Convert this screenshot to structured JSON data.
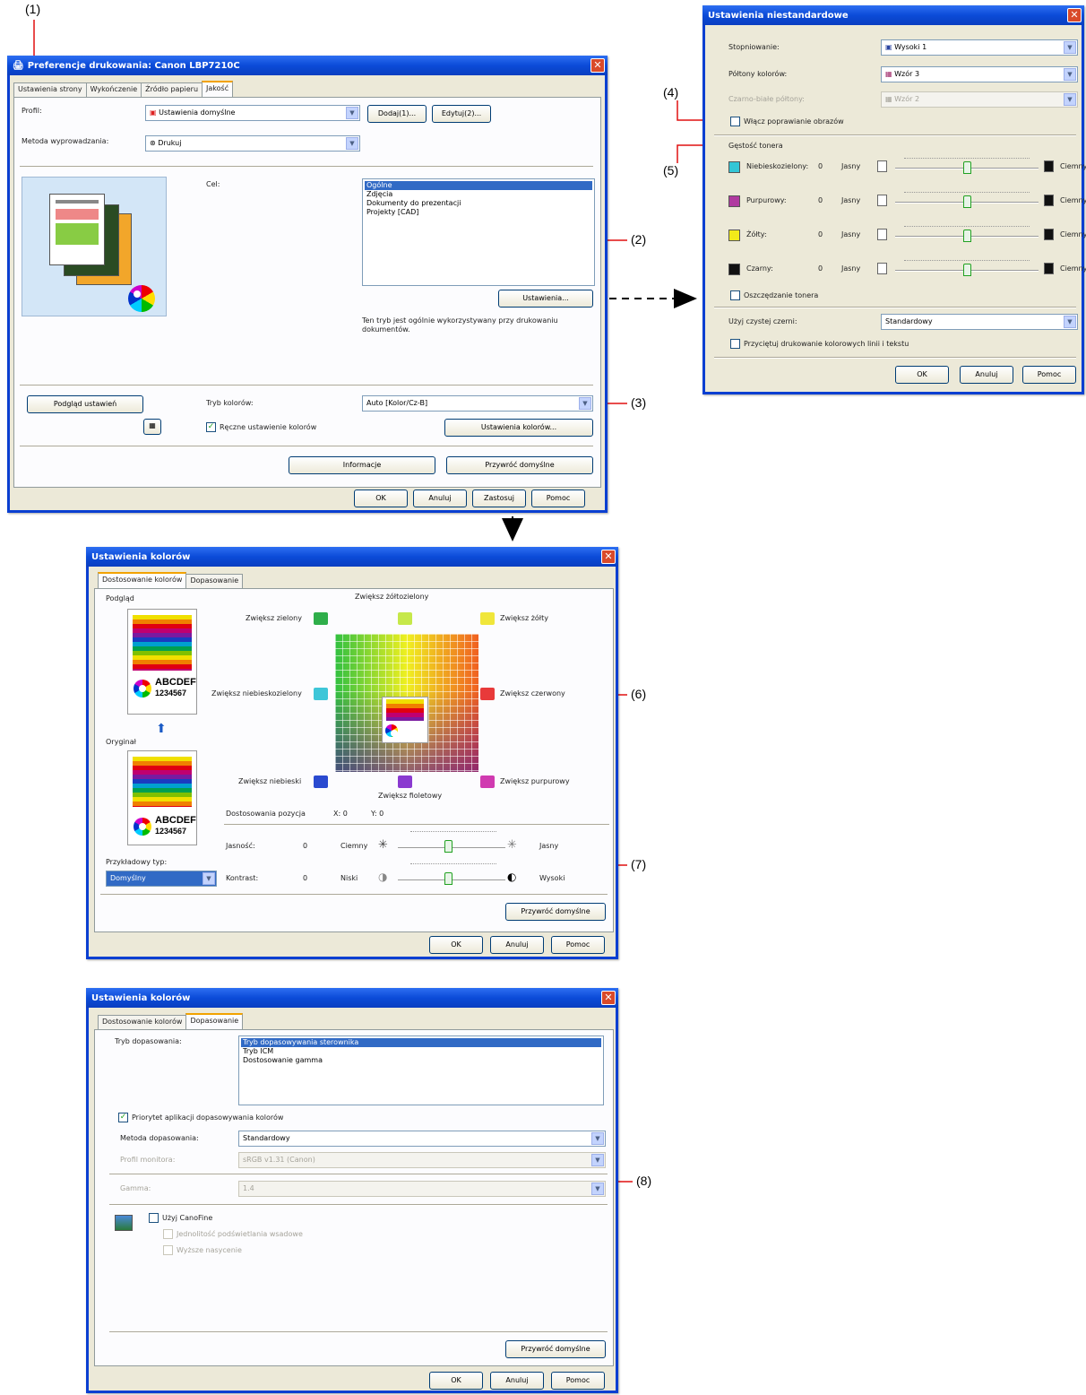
{
  "callouts": {
    "c1": "(1)",
    "c2": "(2)",
    "c3": "(3)",
    "c4": "(4)",
    "c5": "(5)",
    "c6": "(6)",
    "c7": "(7)",
    "c8": "(8)"
  },
  "win1": {
    "title": "Preferencje drukowania: Canon LBP7210C",
    "tabs": [
      "Ustawienia strony",
      "Wykończenie",
      "Źródło papieru",
      "Jakość"
    ],
    "profile_label": "Profil:",
    "profile_value": "Ustawienia domyślne",
    "add_btn": "Dodaj(1)...",
    "edit_btn": "Edytuj(2)...",
    "output_label": "Metoda wyprowadzania:",
    "output_value": "Drukuj",
    "objective_label": "Cel:",
    "objective_items": [
      "Ogólne",
      "Zdjęcia",
      "Dokumenty do prezentacji",
      "Projekty [CAD]"
    ],
    "settings_btn": "Ustawienia...",
    "description": "Ten tryb jest ogólnie wykorzystywany przy drukowaniu dokumentów.",
    "view_settings_btn": "Podgląd ustawień",
    "color_mode_label": "Tryb kolorów:",
    "color_mode_value": "Auto [Kolor/Cz-B]",
    "manual_color_label": "Ręczne ustawienie kolorów",
    "color_settings_btn": "Ustawienia kolorów...",
    "info_btn": "Informacje",
    "restore_btn": "Przywróć domyślne",
    "ok": "OK",
    "cancel": "Anuluj",
    "apply": "Zastosuj",
    "help": "Pomoc"
  },
  "win2": {
    "title": "Ustawienia niestandardowe",
    "gradation_label": "Stopniowanie:",
    "gradation_value": "Wysoki 1",
    "halftone_label": "Półtony kolorów:",
    "halftone_value": "Wzór 3",
    "mono_halftone_label": "Czarno-białe półtony:",
    "mono_halftone_value": "Wzór 2",
    "image_refine_label": "Włącz poprawianie obrazów",
    "toner_density_label": "Gęstość tonera",
    "toner_rows": [
      {
        "name": "Niebieskozielony:",
        "value": "0",
        "swatch": "#33c6d6"
      },
      {
        "name": "Purpurowy:",
        "value": "0",
        "swatch": "#b03aa0"
      },
      {
        "name": "Żółty:",
        "value": "0",
        "swatch": "#f2ea1a"
      },
      {
        "name": "Czarny:",
        "value": "0",
        "swatch": "#111111"
      }
    ],
    "light": "Jasny",
    "dark": "Ciemny",
    "toner_save_label": "Oszczędzanie tonera",
    "pure_black_label": "Użyj czystej czerni:",
    "pure_black_value": "Standardowy",
    "thin_lines_label": "Przyciętuj drukowanie kolorowych linii i tekstu",
    "ok": "OK",
    "cancel": "Anuluj",
    "help": "Pomoc"
  },
  "win3": {
    "title": "Ustawienia kolorów",
    "tabs": [
      "Dostosowanie kolorów",
      "Dopasowanie"
    ],
    "preview_label": "Podgląd",
    "original_label": "Oryginał",
    "sample_line1": "ABCDEF",
    "sample_line2": "1234567",
    "dirs": {
      "yg": "Zwiększ żółtozielony",
      "green": "Zwiększ zielony",
      "yellow": "Zwiększ żółty",
      "cyan": "Zwiększ niebieskozielony",
      "red": "Zwiększ czerwony",
      "blue": "Zwiększ niebieski",
      "magenta": "Zwiększ purpurowy",
      "violet": "Zwiększ fioletowy"
    },
    "position_label": "Dostosowania pozycja",
    "pos_x": "X: 0",
    "pos_y": "Y: 0",
    "brightness_label": "Jasność:",
    "brightness_value": "0",
    "brightness_min": "Ciemny",
    "brightness_max": "Jasny",
    "contrast_label": "Kontrast:",
    "contrast_value": "0",
    "contrast_min": "Niski",
    "contrast_max": "Wysoki",
    "sample_type_label": "Przykładowy typ:",
    "sample_type_value": "Domyślny",
    "restore_btn": "Przywróć domyślne",
    "ok": "OK",
    "cancel": "Anuluj",
    "help": "Pomoc"
  },
  "win4": {
    "title": "Ustawienia kolorów",
    "tabs": [
      "Dostosowanie kolorów",
      "Dopasowanie"
    ],
    "mode_label": "Tryb dopasowania:",
    "mode_items": [
      "Tryb dopasowywania sterownika",
      "Tryb ICM",
      "Dostosowanie gamma"
    ],
    "app_match_label": "Priorytet aplikacji dopasowywania kolorów",
    "method_label": "Metoda dopasowania:",
    "method_value": "Standardowy",
    "monitor_label": "Profil monitora:",
    "monitor_value": "sRGB v1.31 (Canon)",
    "gamma_label": "Gamma:",
    "gamma_value": "1.4",
    "canofine_label": "Użyj CanoFine",
    "canofine_opt1": "Jednolitość podświetlania wsadowe",
    "canofine_opt2": "Wyższe nasycenie",
    "restore_btn": "Przywróć domyślne",
    "ok": "OK",
    "cancel": "Anuluj",
    "help": "Pomoc"
  }
}
